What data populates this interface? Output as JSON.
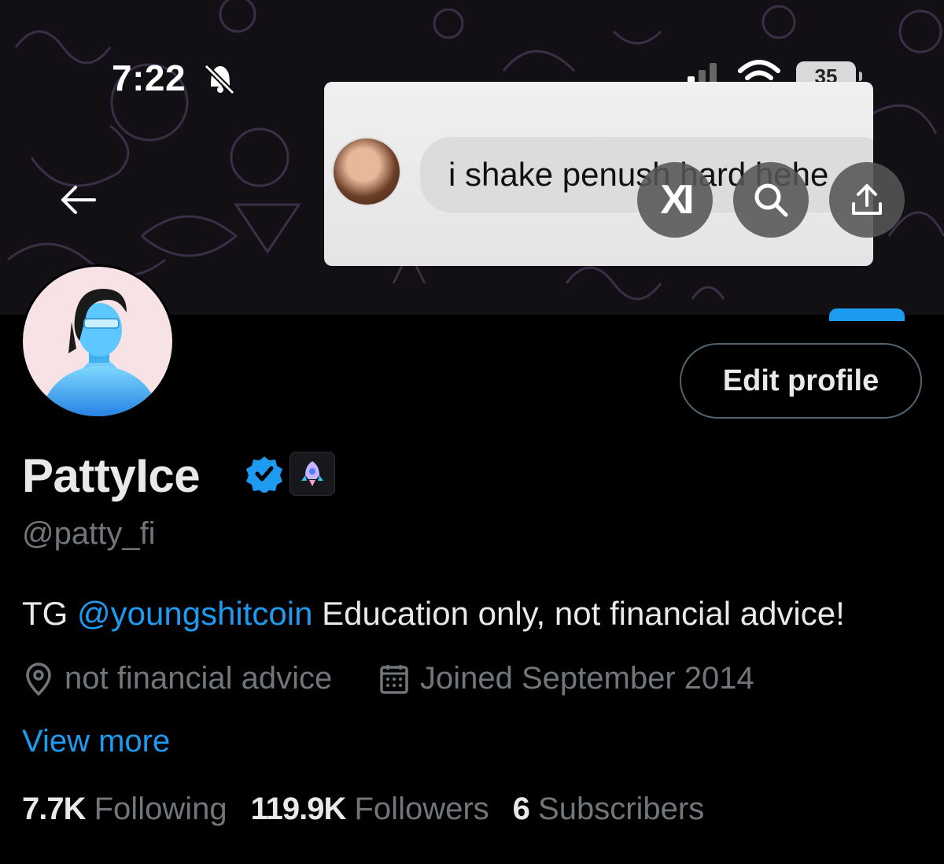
{
  "status_bar": {
    "time": "7:22",
    "battery": "35"
  },
  "banner_overlay": {
    "message_text": "i shake penush hard hehe"
  },
  "header_actions": {
    "grok_label": "XI"
  },
  "profile": {
    "edit_profile_label": "Edit profile",
    "display_name": "PattyIce",
    "handle": "@patty_fi",
    "bio_prefix": "TG ",
    "bio_mention": "@youngshitcoin",
    "bio_suffix": " Education only, not financial advice!",
    "location": "not financial advice",
    "joined": "Joined September 2014",
    "view_more": "View more"
  },
  "stats": [
    {
      "value": "7.7K",
      "label": "Following"
    },
    {
      "value": "119.9K",
      "label": "Followers"
    },
    {
      "value": "6",
      "label": "Subscribers"
    }
  ],
  "colors": {
    "accent": "#1d9bf0",
    "muted": "#71767b",
    "text": "#e7e9ea",
    "background": "#000000"
  }
}
